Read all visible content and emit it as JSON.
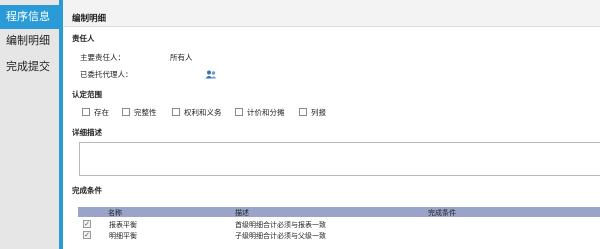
{
  "sidebar": {
    "items": [
      {
        "label": "程序信息",
        "active": true
      },
      {
        "label": "编制明细",
        "active": false
      },
      {
        "label": "完成提交",
        "active": false
      }
    ]
  },
  "page": {
    "title": "编制明细"
  },
  "responsibility": {
    "section_title": "责任人",
    "owner_label": "主要责任人：",
    "owner_value": "所有人",
    "delegate_label": "已委托代理人："
  },
  "scope": {
    "section_title": "认定范围",
    "options": [
      "存在",
      "完整性",
      "权利和义务",
      "计价和分摊",
      "列报"
    ]
  },
  "details": {
    "section_title": "详细描述"
  },
  "completion": {
    "section_title": "完成条件",
    "columns": [
      "名称",
      "描述",
      "完成条件"
    ],
    "rows": [
      {
        "name": "报表平衡",
        "description": "首级明细合计必须与报表一致",
        "condition": "",
        "checked": true
      },
      {
        "name": "明细平衡",
        "description": "子级明细合计必须与父级一致",
        "condition": "",
        "checked": true
      }
    ]
  },
  "colors": {
    "accent": "#2a9bd6",
    "table_header": "#9aa3c8"
  }
}
